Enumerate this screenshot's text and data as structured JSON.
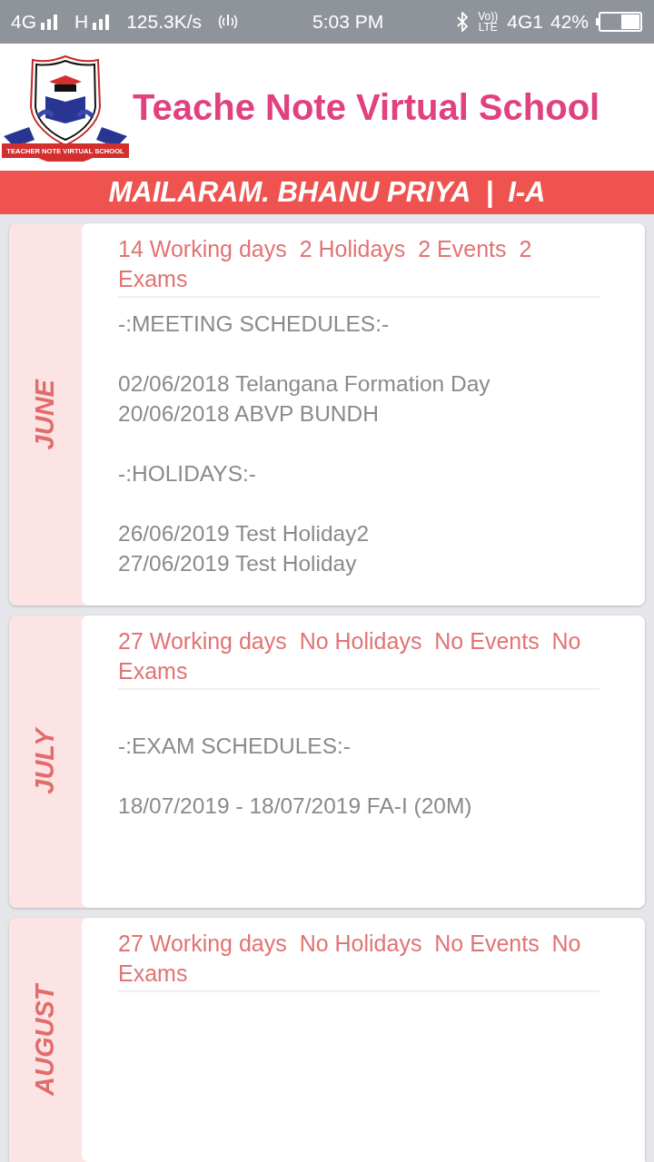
{
  "status_bar": {
    "network_1": "4G",
    "network_2": "H",
    "speed": "125.3K/s",
    "time": "5:03 PM",
    "volte": "Vo)) LTE",
    "network_3": "4G1",
    "battery": "42%"
  },
  "header": {
    "title": "Teache Note Virtual School",
    "logo_text": "TEACHER NOTE VIRTUAL SCHOOL"
  },
  "student_band": {
    "name": "MAILARAM. BHANU PRIYA",
    "separator": "|",
    "class": "I-A"
  },
  "months": [
    {
      "month": "JUNE",
      "summary": "14 Working days  2 Holidays  2 Events  2 Exams",
      "leading_gap": false,
      "trailing_gap": false,
      "blocks": [
        [
          "-:MEETING SCHEDULES:-"
        ],
        [
          "02/06/2018 Telangana Formation Day",
          "20/06/2018 ABVP BUNDH"
        ],
        [
          "-:HOLIDAYS:-"
        ],
        [
          "26/06/2019 Test Holiday2",
          "27/06/2019 Test Holiday"
        ]
      ]
    },
    {
      "month": "JULY",
      "summary": "27 Working days  No Holidays  No Events  No Exams",
      "leading_gap": true,
      "trailing_gap": true,
      "blocks": [
        [
          "-:EXAM SCHEDULES:-"
        ],
        [
          "18/07/2019 - 18/07/2019 FA-I (20M)"
        ]
      ]
    },
    {
      "month": "AUGUST",
      "summary": "27 Working days  No Holidays  No Events  No Exams"
    }
  ]
}
